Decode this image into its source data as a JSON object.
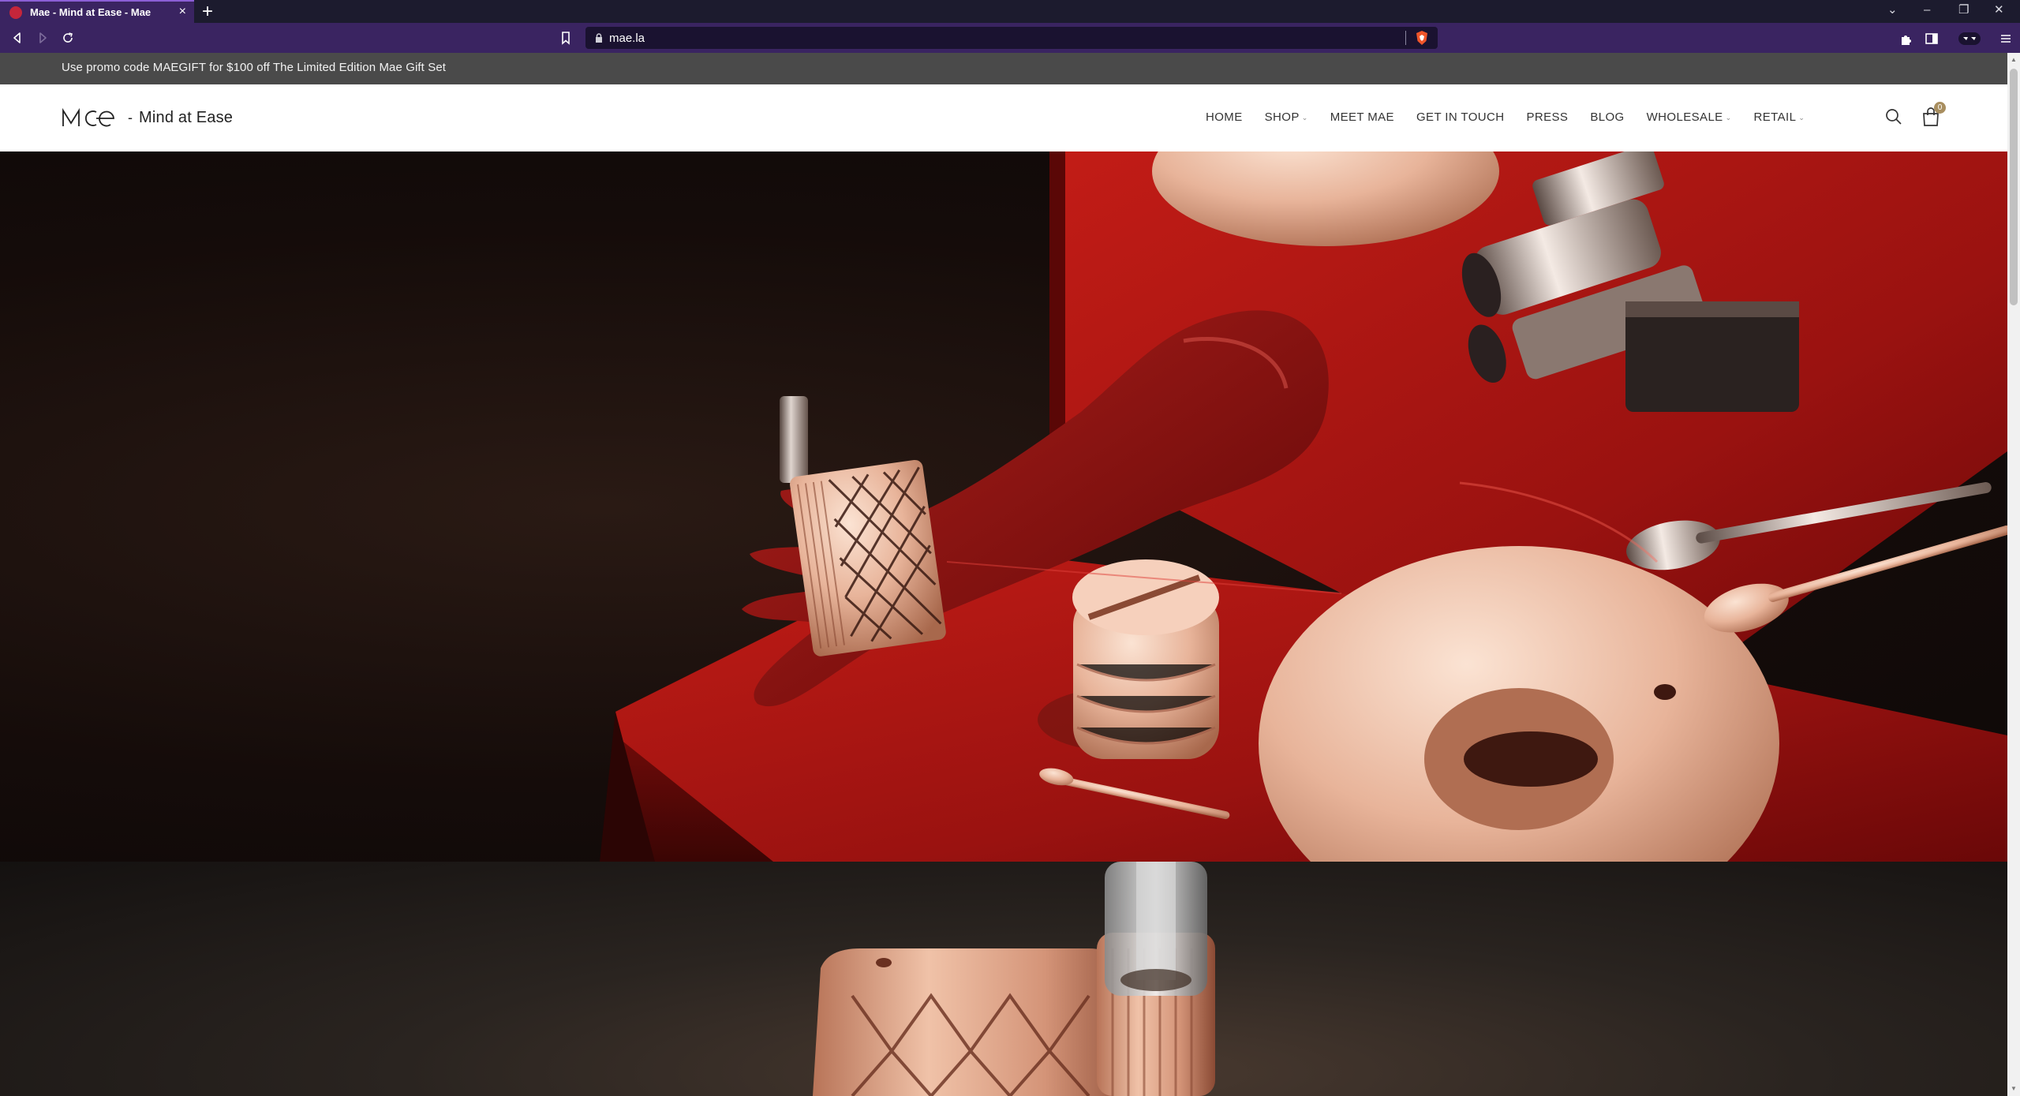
{
  "browser": {
    "tab": {
      "title": "Mae - Mind at Ease - Mae",
      "favicon": "mae-favicon-icon"
    },
    "new_tab_label": "+",
    "url": "mae.la"
  },
  "promo": {
    "text": "Use promo code MAEGIFT for $100 off The Limited Edition Mae Gift Set"
  },
  "header": {
    "logo_mark": "MOe",
    "logo_dash": "-",
    "logo_text": "Mind at Ease",
    "nav": [
      {
        "label": "HOME",
        "has_caret": false
      },
      {
        "label": "SHOP",
        "has_caret": true
      },
      {
        "label": "MEET MAE",
        "has_caret": false
      },
      {
        "label": "GET IN TOUCH",
        "has_caret": false
      },
      {
        "label": "PRESS",
        "has_caret": false
      },
      {
        "label": "BLOG",
        "has_caret": false
      },
      {
        "label": "WHOLESALE",
        "has_caret": true
      },
      {
        "label": "RETAIL",
        "has_caret": true
      }
    ],
    "cart_count": "0"
  },
  "colors": {
    "browser_chrome": "#3a2461",
    "promo_bar": "#4a4a4a",
    "hero_red": "#a01414",
    "rose_gold": "#e8b49a",
    "cart_badge": "#a88e5f"
  }
}
